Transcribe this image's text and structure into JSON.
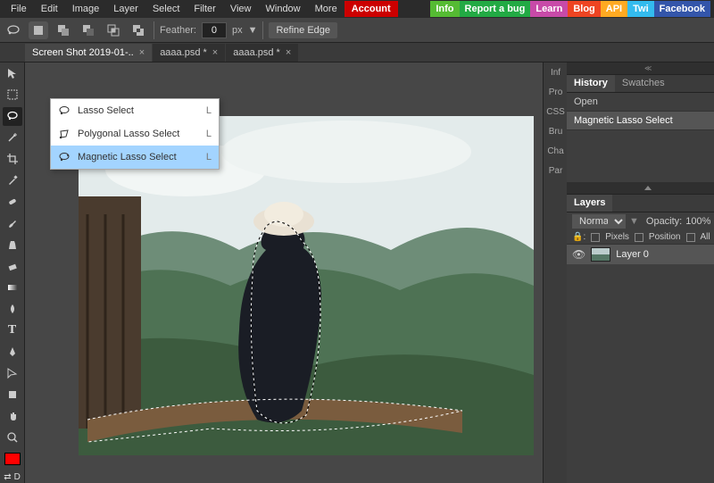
{
  "menu": {
    "items": [
      "File",
      "Edit",
      "Image",
      "Layer",
      "Select",
      "Filter",
      "View",
      "Window",
      "More"
    ],
    "account": "Account",
    "pills": [
      {
        "label": "Info",
        "color": "#55bb33"
      },
      {
        "label": "Report a bug",
        "color": "#22aa44"
      },
      {
        "label": "Learn",
        "color": "#c84aa8"
      },
      {
        "label": "Blog",
        "color": "#ee4422"
      },
      {
        "label": "API",
        "color": "#ffaa22"
      },
      {
        "label": "Twi",
        "color": "#33bbee"
      },
      {
        "label": "Facebook",
        "color": "#3355aa"
      }
    ]
  },
  "options": {
    "feather_label": "Feather:",
    "feather_value": "0",
    "unit": "px",
    "refine": "Refine Edge"
  },
  "tabs": [
    {
      "label": "Screen Shot 2019-01-..",
      "active": true
    },
    {
      "label": "aaaa.psd *",
      "active": false
    },
    {
      "label": "aaaa.psd *",
      "active": false
    }
  ],
  "flyout": {
    "items": [
      {
        "label": "Lasso Select",
        "shortcut": "L",
        "active": false
      },
      {
        "label": "Polygonal Lasso Select",
        "shortcut": "L",
        "active": false
      },
      {
        "label": "Magnetic Lasso Select",
        "shortcut": "L",
        "active": true
      }
    ]
  },
  "right_tabs": [
    "Inf",
    "Pro",
    "CSS",
    "Bru",
    "Cha",
    "Par"
  ],
  "history": {
    "tab1": "History",
    "tab2": "Swatches",
    "items": [
      {
        "label": "Open",
        "selected": false
      },
      {
        "label": "Magnetic Lasso Select",
        "selected": true
      }
    ]
  },
  "layers": {
    "title": "Layers",
    "blend": "Normal",
    "opacity_label": "Opacity:",
    "opacity": "100%",
    "lock_pixels": "Pixels",
    "lock_position": "Position",
    "lock_all": "All",
    "row": {
      "name": "Layer 0"
    }
  },
  "swatch_label": "D"
}
